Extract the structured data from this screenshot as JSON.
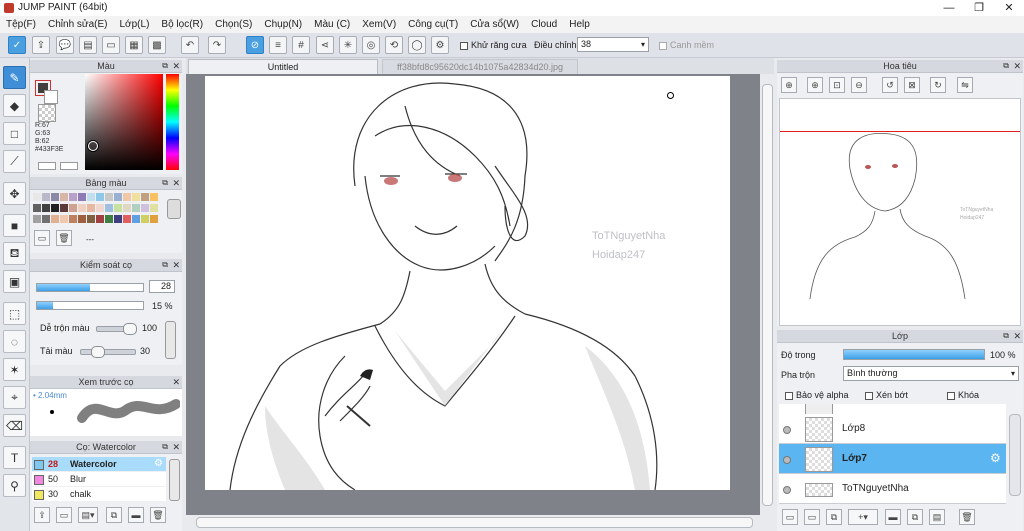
{
  "window": {
    "title": "JUMP PAINT (64bit)"
  },
  "menu": [
    "Tệp(F)",
    "Chỉnh sửa(E)",
    "Lớp(L)",
    "Bộ lọc(R)",
    "Chọn(S)",
    "Chụp(N)",
    "Màu (C)",
    "Xem(V)",
    "Công cụ(T)",
    "Cửa sổ(W)",
    "Cloud",
    "Help"
  ],
  "toolbar": {
    "antialias_label": "Khử răng cưa",
    "correction_label": "Điều chỉnh",
    "correction_value": "38",
    "snap_label": "Canh mềm"
  },
  "color_panel": {
    "title": "Màu",
    "main_color": "#433F3E",
    "r": "R:67",
    "g": "G:63",
    "b": "B:62",
    "hex": "#433F3E"
  },
  "palette_panel": {
    "title": "Bảng màu",
    "swatches": [
      "#e8e8e8",
      "#b9b9c9",
      "#8a8aa6",
      "#d8b6a6",
      "#b9a0c8",
      "#8e7ab5",
      "#c0e0f0",
      "#8ec8e8",
      "#c8c8c8",
      "#9ab0d0",
      "#f0c8a8",
      "#f0e0a0",
      "#c0a080",
      "#f8c060",
      "#606060",
      "#404040",
      "#202020",
      "#5a3a3a",
      "#d0a090",
      "#f0d0c0",
      "#e8b8a0",
      "#f0d8d0",
      "#a0c0e0",
      "#c8e0a0",
      "#e0d8c0",
      "#b0d0c0",
      "#d0c0e0",
      "#e0e0a0",
      "#a0a0a0",
      "#707070",
      "#e0b090",
      "#f0c8b0",
      "#c08060",
      "#a06040",
      "#806040",
      "#a04040",
      "#408040",
      "#404080",
      "#e06060",
      "#60a0e0",
      "#d0d060",
      "#e0a040"
    ],
    "extra": "---"
  },
  "brush_control": {
    "title": "Kiểm soát cọ",
    "size": "28",
    "size_fraction": 0.5,
    "opacity": "15 %",
    "opacity_fraction": 0.15,
    "blend_label": "Dễ trộn màu",
    "blend_value": "100",
    "blend_fraction": 1.0,
    "load_label": "Tải màu",
    "load_value": "30",
    "load_fraction": 0.3
  },
  "brush_preview": {
    "title": "Xem trước cọ",
    "size_label": "2.04mm"
  },
  "brush_list": {
    "title": "Cọ: Watercolor",
    "items": [
      {
        "size": "28",
        "name": "Watercolor",
        "color": "#7ec8f0"
      },
      {
        "size": "50",
        "name": "Blur",
        "color": "#f088e0"
      },
      {
        "size": "30",
        "name": "chalk",
        "color": "#f0e860"
      }
    ]
  },
  "tabs": [
    "Untitled",
    "ff38bfd8c95620dc14b1075a42834d20.jpg"
  ],
  "canvas": {
    "watermark_line1": "ToTNguyetNha",
    "watermark_line2": "Hoidap247"
  },
  "navigator": {
    "title": "Hoa tiêu",
    "wm1": "ToTNguyetNha",
    "wm2": "Hoidap247"
  },
  "layers_panel": {
    "title": "Lớp",
    "opacity_label": "Độ trong",
    "opacity_value": "100 %",
    "opacity_fraction": 1.0,
    "blend_label": "Pha trộn",
    "blend_value": "Bình thường",
    "protect_alpha": "Bảo vệ alpha",
    "clip": "Xén bớt",
    "lock": "Khóa",
    "layers": [
      {
        "name": "Lớp8",
        "selected": false
      },
      {
        "name": "Lớp7",
        "selected": true
      },
      {
        "name": "ToTNguyetNha",
        "selected": false
      }
    ]
  }
}
